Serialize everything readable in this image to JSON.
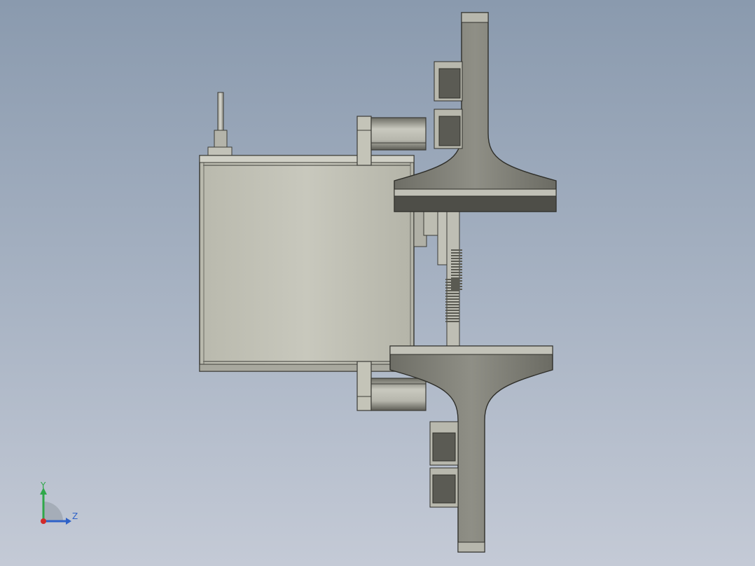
{
  "viewport": {
    "background_top": "#8a9aae",
    "background_bottom": "#c4cad6"
  },
  "model": {
    "body_fill": "#c4c4b8",
    "body_edge": "#3b3b36",
    "dark_fill": "#7a7a70",
    "shadow_fill": "#4b4b45",
    "gear_fill": "#5a5a52"
  },
  "triad": {
    "y_label": "Y",
    "z_label": "Z",
    "y_color": "#2fa84a",
    "z_color": "#2f62c8",
    "x_color": "#d22a2a"
  }
}
